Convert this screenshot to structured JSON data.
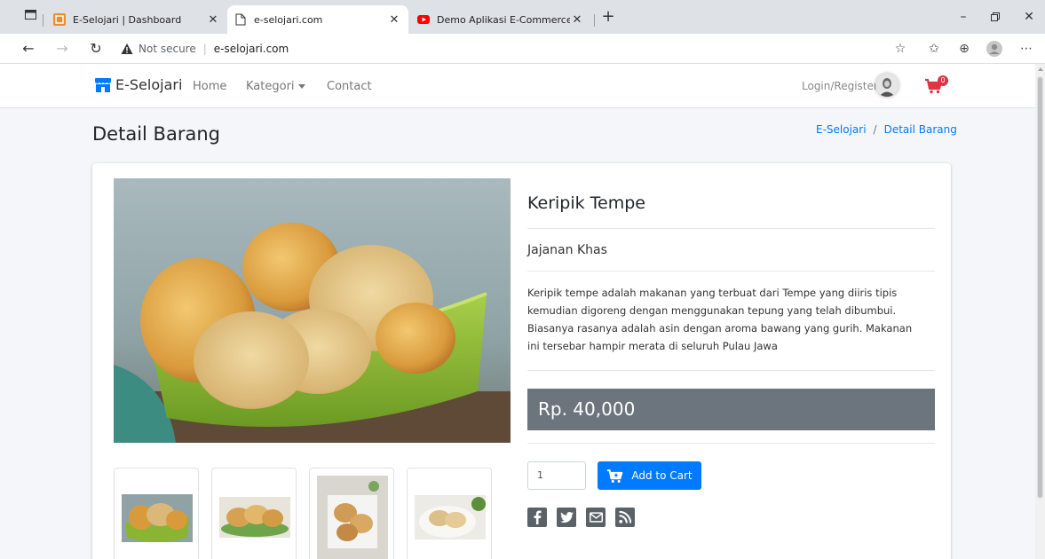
{
  "browser": {
    "tabs": [
      {
        "title": "E-Selojari | Dashboard",
        "favicon": "dashboard-favicon",
        "active": false
      },
      {
        "title": "e-selojari.com",
        "favicon": "page-icon",
        "active": true
      },
      {
        "title": "Demo Aplikasi E-Commerce \"E-S",
        "favicon": "youtube-icon",
        "active": false
      }
    ],
    "new_tab": "+",
    "security_label": "Not secure",
    "url": "e-selojari.com"
  },
  "nav": {
    "brand": "E-Selojari",
    "links": [
      "Home",
      "Kategori",
      "Contact"
    ],
    "login": "Login/Register",
    "cart_count": "0"
  },
  "page": {
    "title": "Detail Barang",
    "breadcrumb": {
      "home": "E-Selojari",
      "separator": "/",
      "current": "Detail Barang"
    }
  },
  "product": {
    "name": "Keripik Tempe",
    "category": "Jajanan Khas",
    "description": "Keripik tempe adalah makanan yang terbuat dari Tempe yang diiris tipis kemudian digoreng dengan menggunakan tepung yang telah dibumbui. Biasanya rasanya adalah asin dengan aroma bawang yang gurih. Makanan ini tersebar hampir merata di seluruh Pulau Jawa",
    "price": "Rp. 40,000",
    "quantity": "1",
    "add_to_cart": "Add to Cart",
    "share": [
      "facebook-icon",
      "twitter-icon",
      "email-icon",
      "rss-icon"
    ]
  },
  "colors": {
    "primary": "#007bff",
    "price_bg": "#6c757d",
    "badge": "#dc3545",
    "bowl_green": "#8ab532"
  }
}
